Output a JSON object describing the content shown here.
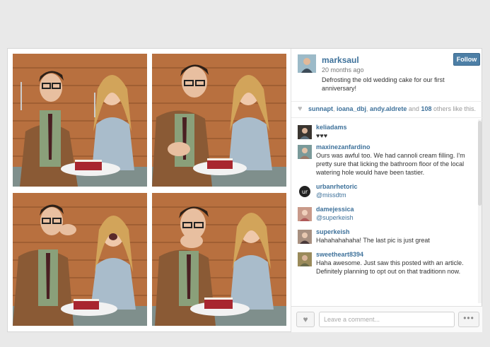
{
  "post": {
    "username": "marksaul",
    "time_ago": "20 months ago",
    "caption": "Defrosting the old wedding cake for our first anniversary!",
    "follow_label": "Follow"
  },
  "likes": {
    "users": [
      "sunnapt",
      "ioana_dbj",
      "andy.aldrete"
    ],
    "count": "108",
    "suffix": "others like this."
  },
  "comments": [
    {
      "user": "keliadams",
      "text": "♥♥♥",
      "mention": false
    },
    {
      "user": "maxinezanfardino",
      "text": "Ours was awful too. We had cannoli cream filling. I'm pretty sure that licking the bathroom floor of the local watering hole would have been tastier.",
      "mention": false
    },
    {
      "user": "urbanrhetoric",
      "text": "@missdtm",
      "mention": true
    },
    {
      "user": "damejessica",
      "text": "@superkeish",
      "mention": true
    },
    {
      "user": "superkeish",
      "text": "Hahahahahaha! The last pic is just great",
      "mention": false
    },
    {
      "user": "sweetheart8394",
      "text": "Haha awesome. Just saw this posted with an article. Definitely planning to opt out on that traditionn now.",
      "mention": false
    }
  ],
  "footer": {
    "comment_placeholder": "Leave a comment...",
    "more_label": "•••"
  },
  "colors": {
    "accent": "#3f729b",
    "follow_button": "#4d7fa6"
  }
}
